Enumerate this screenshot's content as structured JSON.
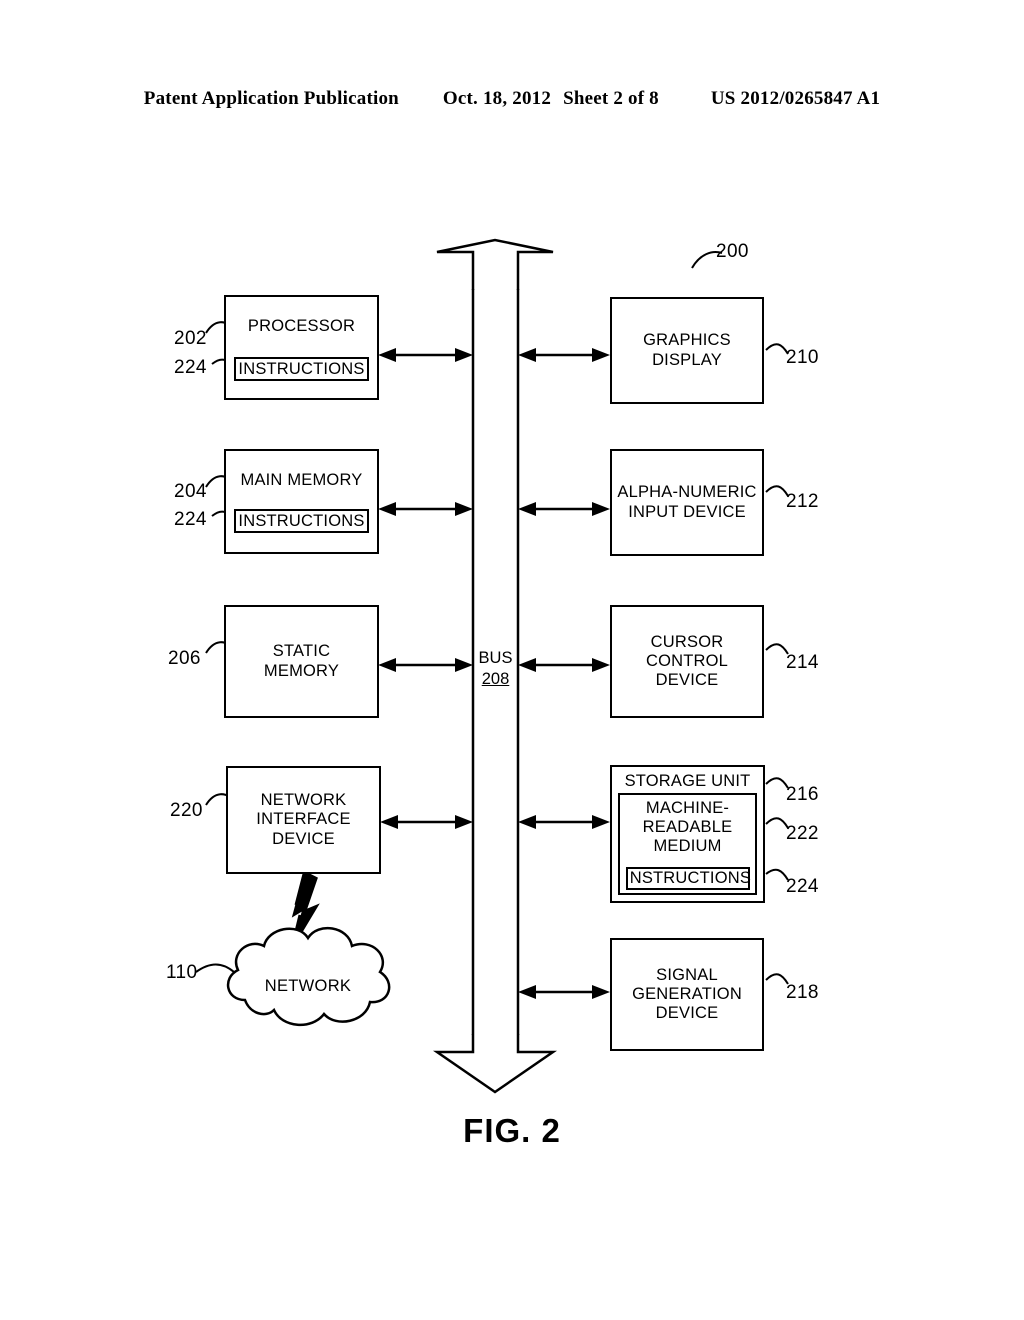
{
  "header": {
    "publication": "Patent Application Publication",
    "date": "Oct. 18, 2012",
    "sheet": "Sheet 2 of 8",
    "patent_number": "US 2012/0265847 A1"
  },
  "figure": {
    "caption": "FIG. 2",
    "system_ref": "200",
    "bus": {
      "label": "BUS",
      "ref": "208"
    },
    "left_blocks": [
      {
        "name": "processor",
        "lines": [
          "PROCESSOR"
        ],
        "ref": "202",
        "sub": {
          "label": "INSTRUCTIONS",
          "ref": "224"
        }
      },
      {
        "name": "main-memory",
        "lines": [
          "MAIN MEMORY"
        ],
        "ref": "204",
        "sub": {
          "label": "INSTRUCTIONS",
          "ref": "224"
        }
      },
      {
        "name": "static-memory",
        "lines": [
          "STATIC",
          "MEMORY"
        ],
        "ref": "206",
        "sub": null
      },
      {
        "name": "network-interface-device",
        "lines": [
          "NETWORK",
          "INTERFACE",
          "DEVICE"
        ],
        "ref": "220",
        "sub": null
      }
    ],
    "right_blocks": [
      {
        "name": "graphics-display",
        "lines": [
          "GRAPHICS",
          "DISPLAY"
        ],
        "ref": "210"
      },
      {
        "name": "alpha-numeric-input-device",
        "lines": [
          "ALPHA-NUMERIC",
          "INPUT DEVICE"
        ],
        "ref": "212"
      },
      {
        "name": "cursor-control-device",
        "lines": [
          "CURSOR",
          "CONTROL",
          "DEVICE"
        ],
        "ref": "214"
      },
      {
        "name": "signal-generation-device",
        "lines": [
          "SIGNAL",
          "GENERATION",
          "DEVICE"
        ],
        "ref": "218"
      }
    ],
    "storage_unit": {
      "title": "STORAGE UNIT",
      "ref": "216",
      "medium": {
        "lines": [
          "MACHINE-",
          "READABLE",
          "MEDIUM"
        ],
        "ref": "222"
      },
      "instructions": {
        "label": "INSTRUCTIONS",
        "ref": "224"
      }
    },
    "network": {
      "label": "NETWORK",
      "ref": "110"
    }
  }
}
